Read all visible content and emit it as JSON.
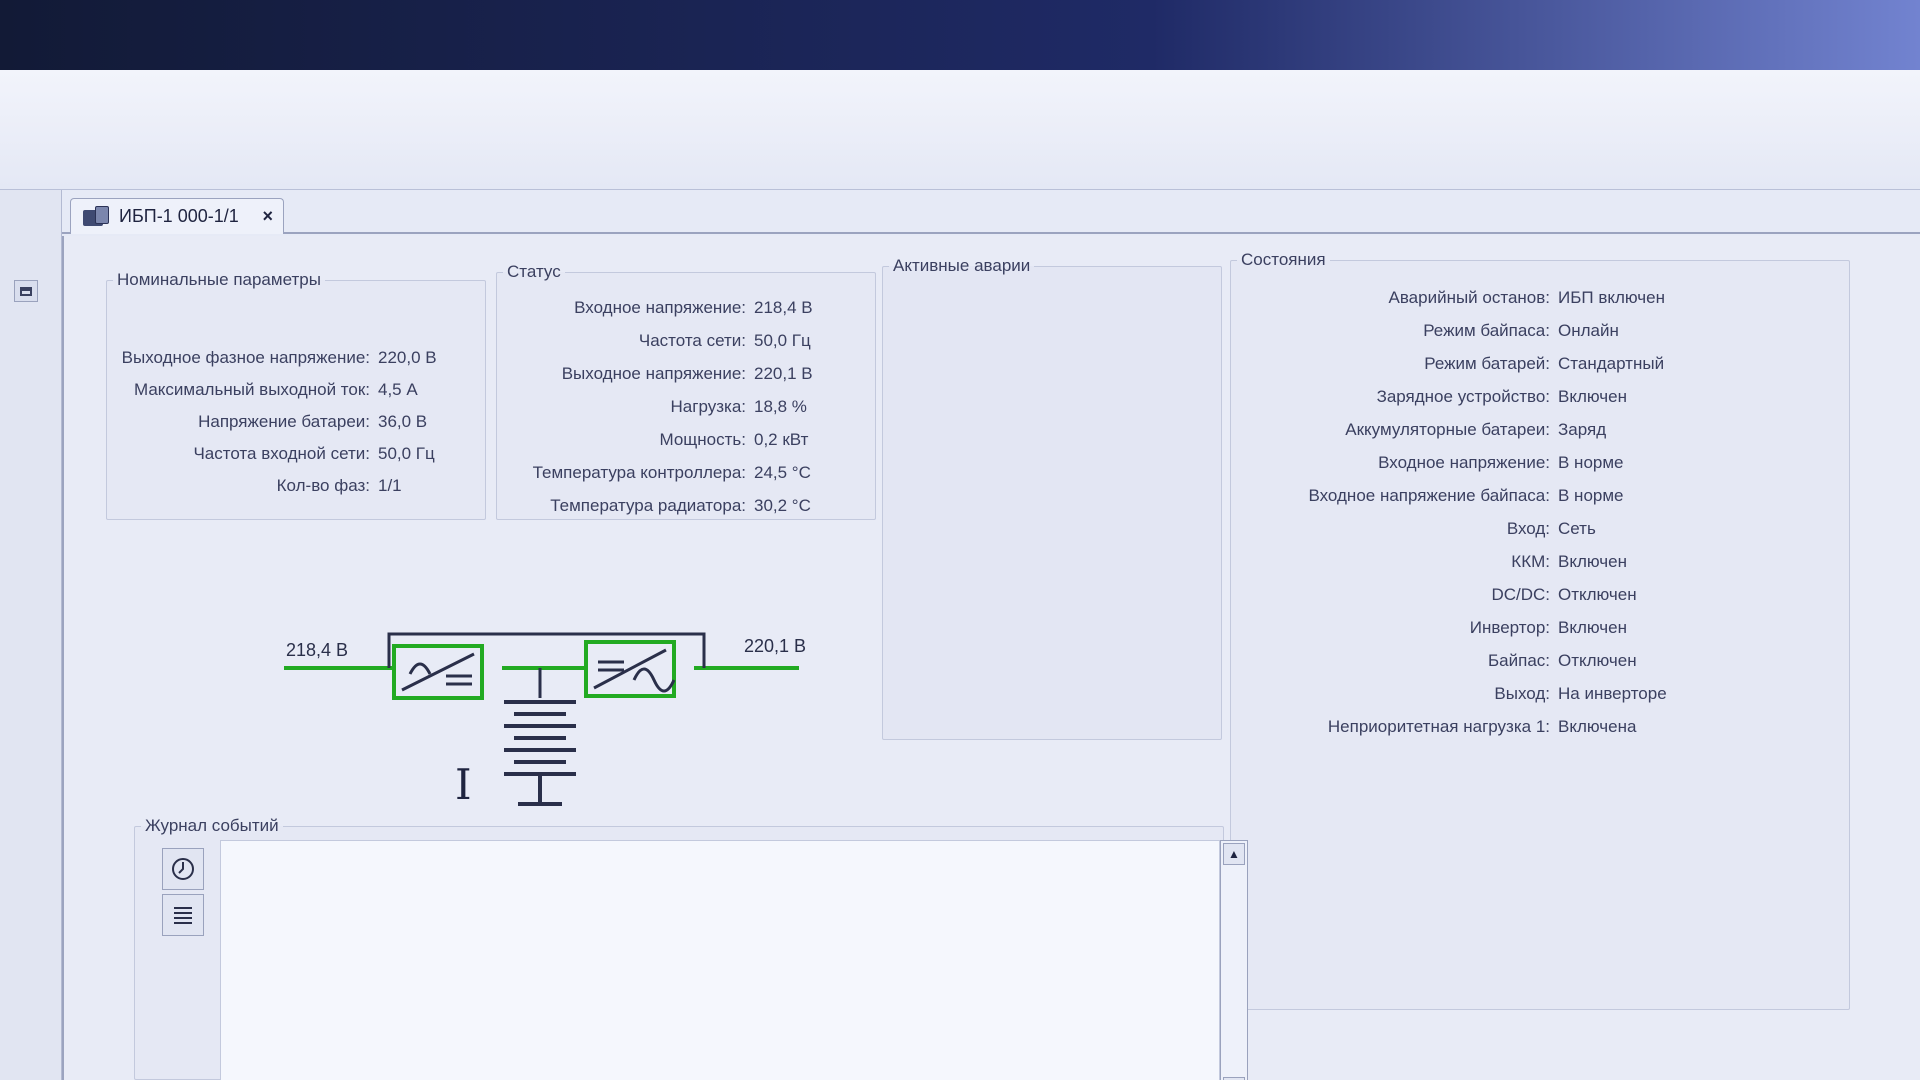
{
  "tab": {
    "title": "ИБП-1 000-1/1",
    "close": "×"
  },
  "nominal": {
    "title": "Номинальные параметры",
    "rows": [
      {
        "label": "Выходное фазное напряжение:",
        "value": "220,0 В"
      },
      {
        "label": "Максимальный выходной ток:",
        "value": "4,5 А"
      },
      {
        "label": "Напряжение батареи:",
        "value": "36,0 В"
      },
      {
        "label": "Частота входной сети:",
        "value": "50,0 Гц"
      },
      {
        "label": "Кол-во фаз:",
        "value": "1/1"
      }
    ]
  },
  "status": {
    "title": "Статус",
    "rows": [
      {
        "label": "Входное напряжение:",
        "value": "218,4 В"
      },
      {
        "label": "Частота сети:",
        "value": "50,0 Гц"
      },
      {
        "label": "Выходное напряжение:",
        "value": "220,1 В"
      },
      {
        "label": "Нагрузка:",
        "value": "18,8 %"
      },
      {
        "label": "Мощность:",
        "value": "0,2 кВт"
      },
      {
        "label": "Температура контроллера:",
        "value": "24,5 °C"
      },
      {
        "label": "Температура радиатора:",
        "value": "30,2 °C"
      }
    ]
  },
  "alarms": {
    "title": "Активные аварии"
  },
  "states": {
    "title": "Состояния",
    "rows": [
      {
        "label": "Аварийный останов:",
        "value": "ИБП включен"
      },
      {
        "label": "Режим байпаса:",
        "value": "Онлайн"
      },
      {
        "label": "Режим батарей:",
        "value": "Стандартный"
      },
      {
        "label": "Зарядное устройство:",
        "value": "Включен"
      },
      {
        "label": "Аккумуляторные батареи:",
        "value": "Заряд"
      },
      {
        "label": "Входное напряжение:",
        "value": "В норме"
      },
      {
        "label": "Входное напряжение байпаса:",
        "value": "В норме"
      },
      {
        "label": "Вход:",
        "value": "Сеть"
      },
      {
        "label": "ККМ:",
        "value": "Включен"
      },
      {
        "label": "DC/DC:",
        "value": "Отключен"
      },
      {
        "label": "Инвертор:",
        "value": "Включен"
      },
      {
        "label": "Байпас:",
        "value": "Отключен"
      },
      {
        "label": "Выход:",
        "value": "На инверторе"
      },
      {
        "label": "Неприоритетная нагрузка 1:",
        "value": "Включена"
      }
    ]
  },
  "diagram": {
    "input_voltage": "218,4 В",
    "output_voltage": "220,1 В",
    "line_color": "#22aa22"
  },
  "log": {
    "title": "Журнал событий"
  }
}
